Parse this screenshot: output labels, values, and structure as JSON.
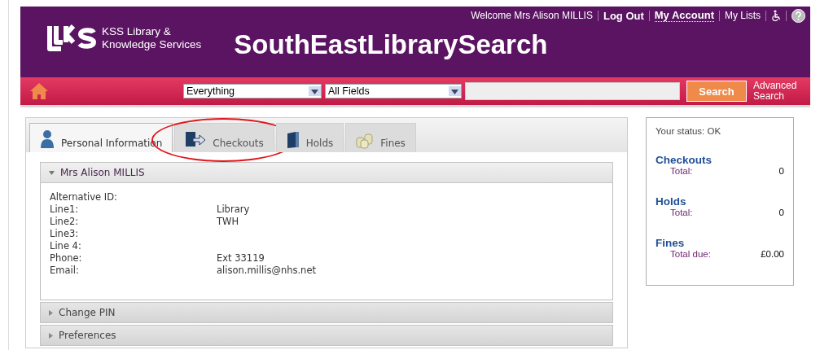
{
  "top_links": [
    {
      "kind": "text",
      "label": "Welcome Mrs Alison MILLIS"
    },
    {
      "kind": "link",
      "label": "Log Out",
      "bold": true,
      "underlined": false
    },
    {
      "kind": "link",
      "label": "My Account",
      "bold": true,
      "underlined": true
    },
    {
      "kind": "link",
      "label": "My Lists",
      "bold": false,
      "underlined": false
    },
    {
      "kind": "accessibility"
    },
    {
      "kind": "help"
    }
  ],
  "logo": {
    "line1": "KSS Library &",
    "line2": "Knowledge Services"
  },
  "site_title": "SouthEastLibrarySearch",
  "search": {
    "scope": "Everything",
    "field": "All Fields",
    "button": "Search",
    "advanced": [
      "Advanced",
      "Search"
    ]
  },
  "tabs": [
    {
      "label": "Personal Information",
      "selected": true,
      "circled": false
    },
    {
      "label": "Checkouts",
      "selected": false,
      "circled": true
    },
    {
      "label": "Holds",
      "selected": false,
      "circled": false
    },
    {
      "label": "Fines",
      "selected": false,
      "circled": false
    }
  ],
  "sections": [
    {
      "title": "Mrs Alison MILLIS",
      "expanded": true,
      "fields": [
        {
          "label": "Alternative ID:"
        },
        {
          "label": "Line1:",
          "value": "Library"
        },
        {
          "label": "Line2:",
          "value": "TWH"
        },
        {
          "label": "Line3:"
        },
        {
          "label": "Line 4:"
        },
        {
          "label": "Phone:",
          "value": "Ext 33119"
        },
        {
          "label": "Email:",
          "value": "alison.millis@nhs.net"
        }
      ]
    },
    {
      "title": "Change PIN",
      "expanded": false
    },
    {
      "title": "Preferences",
      "expanded": false
    }
  ],
  "status": {
    "text": "Your status: OK",
    "groups": [
      {
        "title": "Checkouts",
        "label": "Total:",
        "value": "0"
      },
      {
        "title": "Holds",
        "label": "Total:",
        "value": "0"
      },
      {
        "title": "Fines",
        "label": "Total due:",
        "value": "£0.00"
      }
    ]
  }
}
